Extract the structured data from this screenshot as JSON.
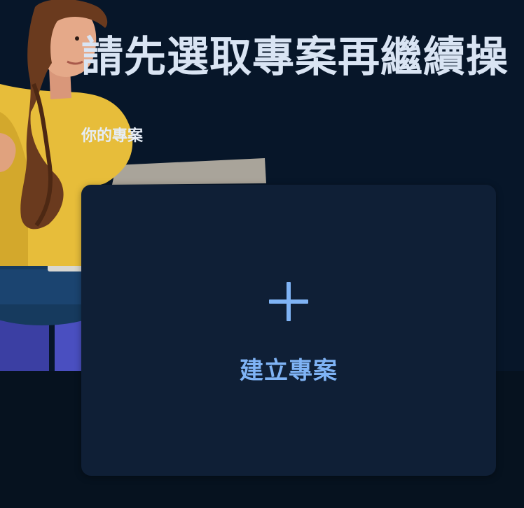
{
  "header": {
    "title": "請先選取專案再繼續操"
  },
  "projects": {
    "section_label": "你的專案",
    "create_card": {
      "icon": "plus-icon",
      "label": "建立專案"
    }
  },
  "colors": {
    "background": "#06121f",
    "card": "#0f1f36",
    "accent": "#7fb3f5",
    "title": "#d9e4f3"
  }
}
